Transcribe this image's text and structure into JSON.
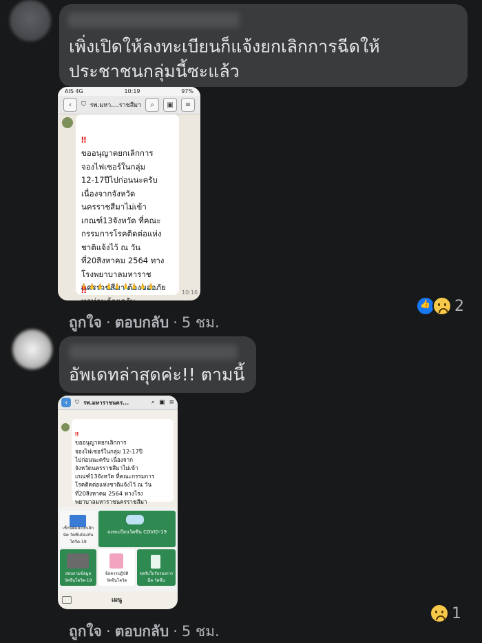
{
  "comments": [
    {
      "text": "เพิ่งเปิดให้ลงทะเบียนก็แจ้งยกเลิกการฉีดให้\nประชาชนกลุ่มนี้ซะแล้ว",
      "actions": {
        "like": "ถูกใจ",
        "reply": "ตอบกลับ",
        "time": "5 ชม."
      },
      "reactions": {
        "icons": [
          "like-icon",
          "sad-icon"
        ],
        "count": "2"
      },
      "attachment": {
        "status_carrier": "AIS 4G",
        "status_time": "10:19",
        "status_battery": "97%",
        "chat_title": "รพ.มหา....ราชสีมา",
        "message_lines": "ขออนุญาตยกเลิกการ\nจองไฟเซอร์ในกลุ่ม\n12-17ปีไปก่อนนะครับ\nเนื่องจากจังหวัด\nนครราชสีมาไม่เข้า\nเกณฑ์13จังหวัด ที่คณะ\nกรรมการโรคติดต่อแห่ง\nชาติแจ้งไว้ ณ วัน\nที่20สิงหาคม 2564 ทาง\nโรงพยาบาลมหาราช\nนครราชสีมา ต้องขออภัย\nทุกท่านด้วยครับ",
        "hands": "🙏🙏🙏🙏🙏🙏🙏🙏🙏",
        "marks": "‼",
        "msg_time": "10:16"
      }
    },
    {
      "text": "อัพเดทล่าสุดค่ะ!! ตามนี้",
      "actions": {
        "like": "ถูกใจ",
        "reply": "ตอบกลับ",
        "time": "5 ชม."
      },
      "reactions": {
        "icons": [
          "sad-icon"
        ],
        "count": "1"
      },
      "attachment": {
        "chat_title": "รพ.มหาราชนคร...",
        "message_lines": "ขออนุญาตยกเลิกการ\nจองไฟเซอร์ในกลุ่ม 12-17ปี\nไปก่อนนะครับ เนื่องจาก\nจังหวัดนครราชสีมาไม่เข้า\nเกณฑ์13จังหวัด ที่คณะกรรมการ\nโรคติดต่อแห่งชาติแจ้งไว้ ณ วัน\nที่20สิงหาคม 2564 ทางโรง\nพยาบาลมหาราชนครราชสีมา\nต้องขออภัยทุกท่านด้วยครับ",
        "marks": "‼",
        "menu_tiles": [
          "เช็กนัดและยกเลิกนัด\nวัคซีนป้องกันโควิด-19",
          "ลงทะเบียนวัคซีน COVID-19",
          "สอบถามข้อมูล\nวัคซีนโควิด-19",
          "ข้อควรปฏิบัติ\nวัคซีนโควิด",
          "ขอรับใบรับรองการฉีด\nวัคซีน"
        ],
        "menu_label": "เมนู"
      }
    }
  ],
  "colors": {
    "background": "#18191a",
    "bubble": "#3a3b3c",
    "text": "#e4e6eb",
    "muted": "#b0b3b8",
    "line_green": "#2f8a52",
    "like_blue": "#1877f2"
  }
}
